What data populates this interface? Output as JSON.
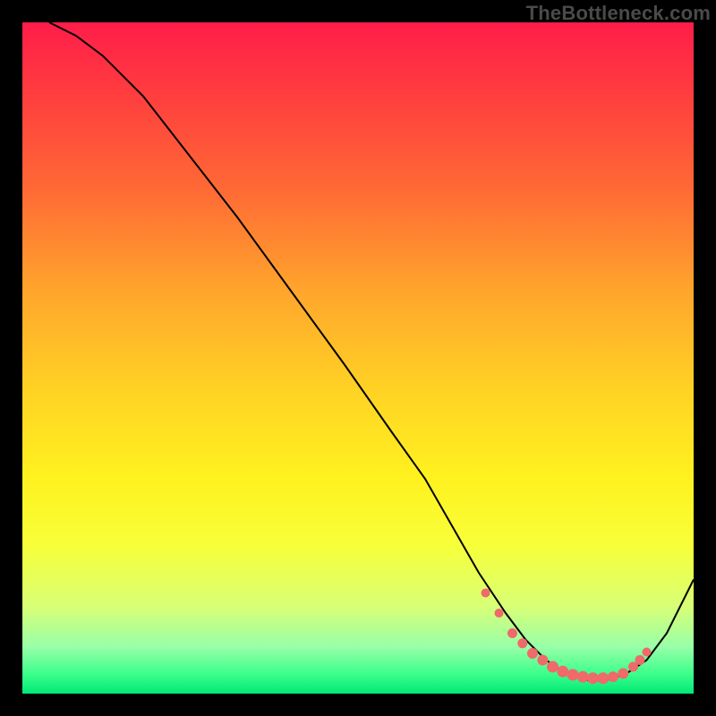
{
  "attribution": "TheBottleneck.com",
  "colors": {
    "marker": "#ef6a6a",
    "curve": "#000000",
    "top": "#ff1d4a",
    "bottom": "#00e877"
  },
  "chart_data": {
    "type": "line",
    "title": "",
    "xlabel": "",
    "ylabel": "",
    "xlim": [
      0,
      100
    ],
    "ylim": [
      0,
      100
    ],
    "grid": false,
    "legend": false,
    "series": [
      {
        "name": "curve",
        "x": [
          4,
          8,
          12,
          18,
          25,
          32,
          40,
          48,
          55,
          60,
          64,
          68,
          72,
          75,
          78,
          81,
          84,
          87,
          90,
          93,
          96,
          100
        ],
        "y": [
          100,
          98,
          95,
          89,
          80,
          71,
          60,
          49,
          39,
          32,
          25,
          18,
          12,
          8,
          5,
          3,
          2,
          2,
          3,
          5,
          9,
          17
        ]
      }
    ],
    "markers": {
      "name": "optimal-range-dots",
      "x": [
        69,
        71,
        73,
        74.5,
        76,
        77.5,
        79,
        80.5,
        82,
        83.5,
        85,
        86.5,
        88,
        89.5,
        91,
        92,
        93
      ],
      "y": [
        15,
        12,
        9,
        7.5,
        6,
        5,
        4,
        3.3,
        2.8,
        2.5,
        2.3,
        2.3,
        2.5,
        3,
        4,
        5,
        6.2
      ],
      "r": [
        5,
        5,
        5.5,
        5.5,
        6,
        6,
        6.5,
        6.5,
        6.5,
        6.5,
        6.5,
        6.5,
        6,
        6,
        5.5,
        5.5,
        5
      ]
    }
  }
}
